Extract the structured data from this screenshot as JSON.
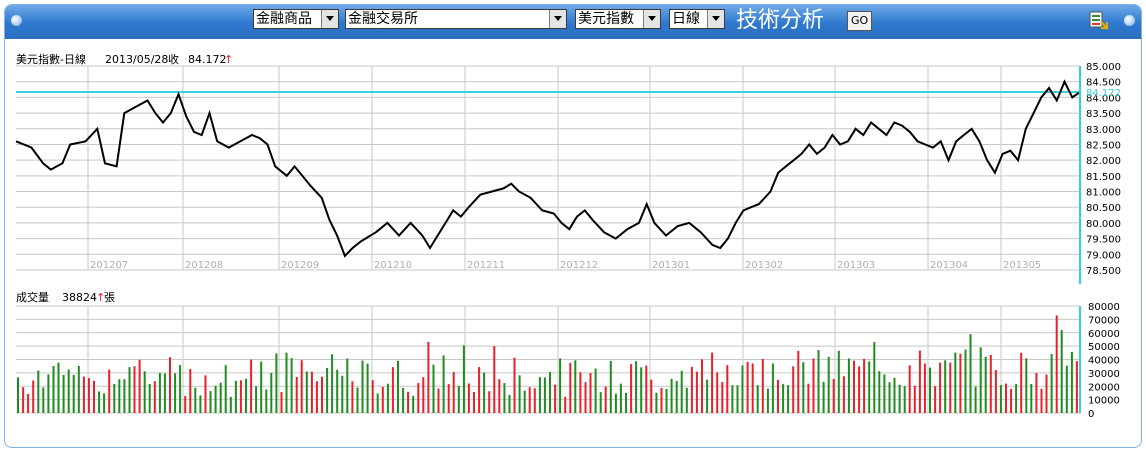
{
  "toolbar": {
    "category_select": "金融商品",
    "exchange_select": "金融交易所",
    "symbol_select": "美元指數",
    "period_select": "日線",
    "title": "技術分析",
    "go_label": "GO",
    "export_icon": "excel-export-icon"
  },
  "colors": {
    "price_line": "#000000",
    "last_price_line": "#33d0e0",
    "volume_up": "#e8202a",
    "volume_down": "#1f8c1f",
    "grid": "#c8c8c8",
    "axis": "#33d0e0"
  },
  "chart_data": [
    {
      "type": "line",
      "info": {
        "name": "美元指數-日線",
        "date": "2013/05/28",
        "close_label": "收",
        "close": "84.172",
        "arrow": "↑"
      },
      "last_value_label": "84.172",
      "ylim": [
        78.5,
        85.0
      ],
      "y_ticks": [
        "85.000",
        "84.500",
        "84.000",
        "83.500",
        "83.000",
        "82.500",
        "82.000",
        "81.500",
        "81.000",
        "80.500",
        "80.000",
        "79.500",
        "79.000",
        "78.500"
      ],
      "x_month_labels": [
        "201207",
        "201208",
        "201209",
        "201210",
        "201211",
        "201212",
        "201301",
        "201302",
        "201303",
        "201304",
        "201305"
      ],
      "anchors": [
        [
          0,
          82.6
        ],
        [
          4,
          82.4
        ],
        [
          7,
          81.9
        ],
        [
          9,
          81.7
        ],
        [
          12,
          81.9
        ],
        [
          14,
          82.5
        ],
        [
          18,
          82.6
        ],
        [
          21,
          83.0
        ],
        [
          23,
          81.9
        ],
        [
          26,
          81.8
        ],
        [
          28,
          83.5
        ],
        [
          31,
          83.7
        ],
        [
          34,
          83.9
        ],
        [
          36,
          83.5
        ],
        [
          38,
          83.2
        ],
        [
          40,
          83.5
        ],
        [
          42,
          84.1
        ],
        [
          44,
          83.4
        ],
        [
          46,
          82.9
        ],
        [
          48,
          82.8
        ],
        [
          50,
          83.5
        ],
        [
          52,
          82.6
        ],
        [
          55,
          82.4
        ],
        [
          58,
          82.6
        ],
        [
          61,
          82.8
        ],
        [
          63,
          82.7
        ],
        [
          65,
          82.5
        ],
        [
          67,
          81.8
        ],
        [
          70,
          81.5
        ],
        [
          72,
          81.8
        ],
        [
          74,
          81.5
        ],
        [
          76,
          81.2
        ],
        [
          79,
          80.8
        ],
        [
          81,
          80.1
        ],
        [
          83,
          79.6
        ],
        [
          85,
          78.95
        ],
        [
          87,
          79.2
        ],
        [
          89,
          79.4
        ],
        [
          91,
          79.55
        ],
        [
          93,
          79.7
        ],
        [
          96,
          80.0
        ],
        [
          99,
          79.6
        ],
        [
          102,
          80.0
        ],
        [
          105,
          79.6
        ],
        [
          107,
          79.2
        ],
        [
          109,
          79.6
        ],
        [
          111,
          80.0
        ],
        [
          113,
          80.4
        ],
        [
          115,
          80.2
        ],
        [
          117,
          80.5
        ],
        [
          120,
          80.9
        ],
        [
          123,
          81.0
        ],
        [
          126,
          81.1
        ],
        [
          128,
          81.25
        ],
        [
          130,
          81.0
        ],
        [
          133,
          80.8
        ],
        [
          136,
          80.4
        ],
        [
          139,
          80.3
        ],
        [
          141,
          80.0
        ],
        [
          143,
          79.8
        ],
        [
          145,
          80.2
        ],
        [
          147,
          80.4
        ],
        [
          149,
          80.1
        ],
        [
          152,
          79.7
        ],
        [
          155,
          79.5
        ],
        [
          158,
          79.8
        ],
        [
          161,
          80.0
        ],
        [
          163,
          80.6
        ],
        [
          165,
          80.0
        ],
        [
          168,
          79.6
        ],
        [
          171,
          79.9
        ],
        [
          174,
          80.0
        ],
        [
          177,
          79.7
        ],
        [
          180,
          79.3
        ],
        [
          182,
          79.2
        ],
        [
          184,
          79.5
        ],
        [
          186,
          80.0
        ],
        [
          188,
          80.4
        ],
        [
          190,
          80.5
        ],
        [
          192,
          80.6
        ],
        [
          195,
          81.0
        ],
        [
          197,
          81.6
        ],
        [
          199,
          81.8
        ],
        [
          201,
          82.0
        ],
        [
          203,
          82.2
        ],
        [
          205,
          82.5
        ],
        [
          207,
          82.2
        ],
        [
          209,
          82.4
        ],
        [
          211,
          82.8
        ],
        [
          213,
          82.5
        ],
        [
          215,
          82.6
        ],
        [
          217,
          83.0
        ],
        [
          219,
          82.8
        ],
        [
          221,
          83.2
        ],
        [
          223,
          83.0
        ],
        [
          225,
          82.8
        ],
        [
          227,
          83.2
        ],
        [
          229,
          83.1
        ],
        [
          231,
          82.9
        ],
        [
          233,
          82.6
        ],
        [
          235,
          82.5
        ],
        [
          237,
          82.4
        ],
        [
          239,
          82.6
        ],
        [
          241,
          82.0
        ],
        [
          243,
          82.6
        ],
        [
          245,
          82.8
        ],
        [
          247,
          83.0
        ],
        [
          249,
          82.6
        ],
        [
          251,
          82.0
        ],
        [
          253,
          81.6
        ],
        [
          255,
          82.2
        ],
        [
          257,
          82.3
        ],
        [
          259,
          82.0
        ],
        [
          261,
          83.0
        ],
        [
          263,
          83.5
        ],
        [
          265,
          84.0
        ],
        [
          267,
          84.3
        ],
        [
          269,
          83.9
        ],
        [
          271,
          84.5
        ],
        [
          273,
          84.0
        ],
        [
          275,
          84.17
        ]
      ],
      "n_days": 276
    },
    {
      "type": "bar",
      "info": {
        "label": "成交量",
        "value": "38824",
        "arrow": "↑",
        "unit": "張"
      },
      "ylim": [
        0,
        80000
      ],
      "y_ticks": [
        "80000",
        "70000",
        "60000",
        "50000",
        "40000",
        "30000",
        "20000",
        "10000",
        "0"
      ],
      "n_bars": 210,
      "range_note": "volumes mostly 10000–50000, peaks near 73000"
    }
  ]
}
